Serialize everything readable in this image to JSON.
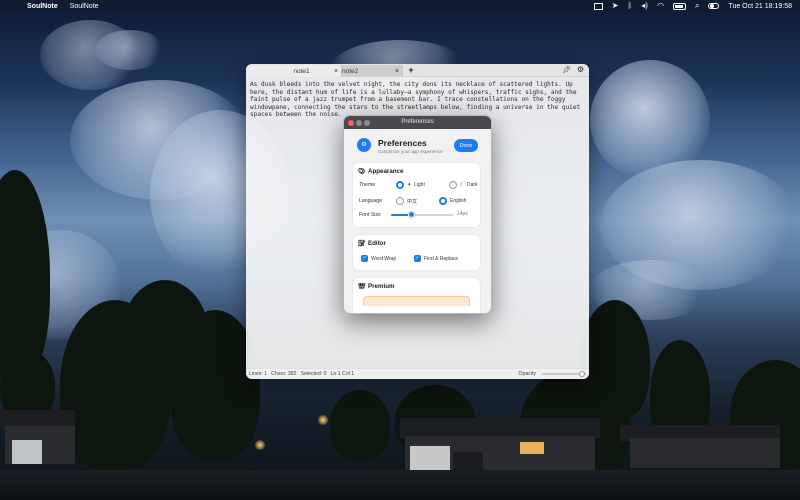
{
  "menubar": {
    "app_name": "SoulNote",
    "menus": [
      "SoulNote"
    ],
    "clock": "Tue Oct 21  18:19:58",
    "status_icons": [
      "battery-icon",
      "location-icon",
      "bluetooth-icon",
      "volume-icon",
      "wifi-icon",
      "control-center-icon",
      "search-icon",
      "toggle-icon"
    ]
  },
  "editor_window": {
    "tabs": [
      {
        "label": "note1",
        "active": false
      },
      {
        "label": "note2",
        "active": true
      }
    ],
    "add_tab": "+",
    "text": "As dusk bleeds into the velvet night, the city dons its necklace of scattered lights. Up here, the distant hum of life is a lullaby—a symphony of whispers, traffic sighs, and the faint pulse of a jazz trumpet from a basement bar. I trace constellations on the foggy windowpane, connecting the stars to the streetlamps below, finding a universe in the quiet spaces between the noise.",
    "status": {
      "lines": "Lines: 1",
      "chars": "Chars: 382",
      "selected": "Selected: 0",
      "position": "Ln 1 Col 1",
      "opacity_label": "Opacity",
      "opacity_value": 0.9
    }
  },
  "preferences": {
    "window_title": "Preferences",
    "heading": "Preferences",
    "subtitle": "Customize your app experience",
    "done_label": "Done",
    "appearance": {
      "title": "Appearance",
      "icon": "palette-icon",
      "theme_label": "Theme",
      "theme_options": [
        {
          "glyph": "☀",
          "label": "Light",
          "selected": true
        },
        {
          "glyph": "☾",
          "label": "Dark",
          "selected": false
        }
      ],
      "language_label": "Language",
      "language_options": [
        {
          "label": "中文",
          "selected": false
        },
        {
          "label": "English",
          "selected": true
        }
      ],
      "font_size_label": "Font Size",
      "font_size_value": "14px",
      "font_size_fraction": 0.33
    },
    "editor": {
      "title": "Editor",
      "icon": "note-icon",
      "options": [
        {
          "label": "Word Wrap",
          "checked": true
        },
        {
          "label": "Find & Replace",
          "checked": true
        }
      ]
    },
    "premium": {
      "title": "Premium",
      "icon": "crown-icon"
    }
  },
  "colors": {
    "accent": "#1e7cf2",
    "close": "#ff5f57"
  }
}
